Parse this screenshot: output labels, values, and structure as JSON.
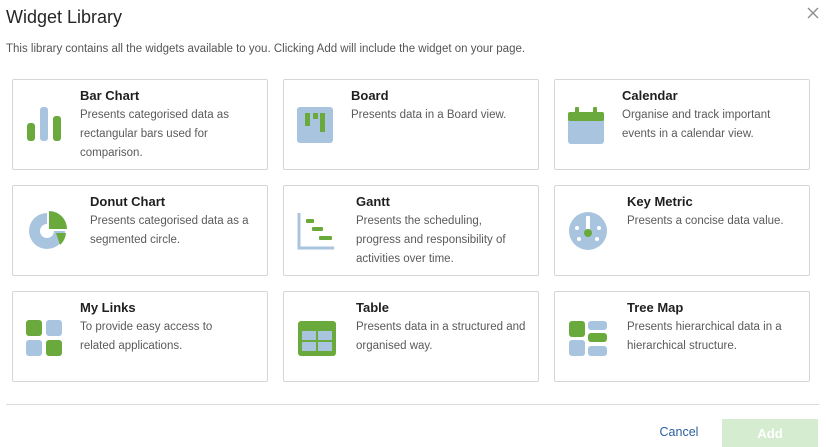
{
  "dialog": {
    "title": "Widget Library",
    "description": "This library contains all the widgets available to you. Clicking Add will include the widget on your page."
  },
  "widgets": [
    {
      "name": "Bar Chart",
      "description": "Presents categorised data as rectangular bars used for comparison.",
      "icon": "bar-chart-icon"
    },
    {
      "name": "Board",
      "description": "Presents data in a Board view.",
      "icon": "board-icon"
    },
    {
      "name": "Calendar",
      "description": "Organise and track important events in a calendar view.",
      "icon": "calendar-icon"
    },
    {
      "name": "Donut Chart",
      "description": "Presents categorised data as a segmented circle.",
      "icon": "donut-chart-icon"
    },
    {
      "name": "Gantt",
      "description": "Presents the scheduling, progress and responsibility of activities over time.",
      "icon": "gantt-icon"
    },
    {
      "name": "Key Metric",
      "description": "Presents a concise data value.",
      "icon": "key-metric-icon"
    },
    {
      "name": "My Links",
      "description": "To provide easy access to related applications.",
      "icon": "my-links-icon"
    },
    {
      "name": "Table",
      "description": "Presents data in a structured and organised way.",
      "icon": "table-icon"
    },
    {
      "name": "Tree Map",
      "description": "Presents hierarchical data in a hierarchical structure.",
      "icon": "tree-map-icon"
    }
  ],
  "footer": {
    "cancel_label": "Cancel",
    "add_label": "Add",
    "add_enabled": false
  },
  "colors": {
    "icon_green": "#6aaa3c",
    "icon_blue": "#a8c4de",
    "link_blue": "#2b5f9e",
    "add_disabled_bg": "#d5ecd0"
  }
}
